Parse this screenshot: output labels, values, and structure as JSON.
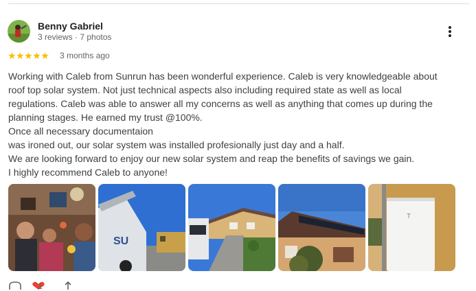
{
  "reviewer": {
    "name": "Benny Gabriel",
    "meta": "3 reviews · 7 photos"
  },
  "rating": {
    "stars": 5,
    "stars_text": "★★★★★",
    "date": "3 months ago"
  },
  "review": {
    "lines": [
      "Working with Caleb from Sunrun has been wonderful experience. Caleb is very knowledgeable about",
      "roof top solar system. Not just technical aspects also including required state as well as local",
      "regulations. Caleb was able to answer all my concerns as well as anything that comes up during the",
      "planning stages. He earned my trust @100%.",
      "Once all necessary documentaion",
      "was ironed out, our solar system was installed profesionally just day and a half.",
      "We are looking forward to enjoy our new solar system and reap the benefits of savings we gain.",
      "I highly recommend Caleb to anyone!"
    ]
  },
  "photos": [
    {
      "name": "group-photo"
    },
    {
      "name": "truck-photo"
    },
    {
      "name": "driveway-photo"
    },
    {
      "name": "roof-panels-photo"
    },
    {
      "name": "battery-photo"
    }
  ],
  "actions": {
    "like_count": "1",
    "icons": [
      "like-icon",
      "love-icon",
      "share-icon"
    ]
  }
}
